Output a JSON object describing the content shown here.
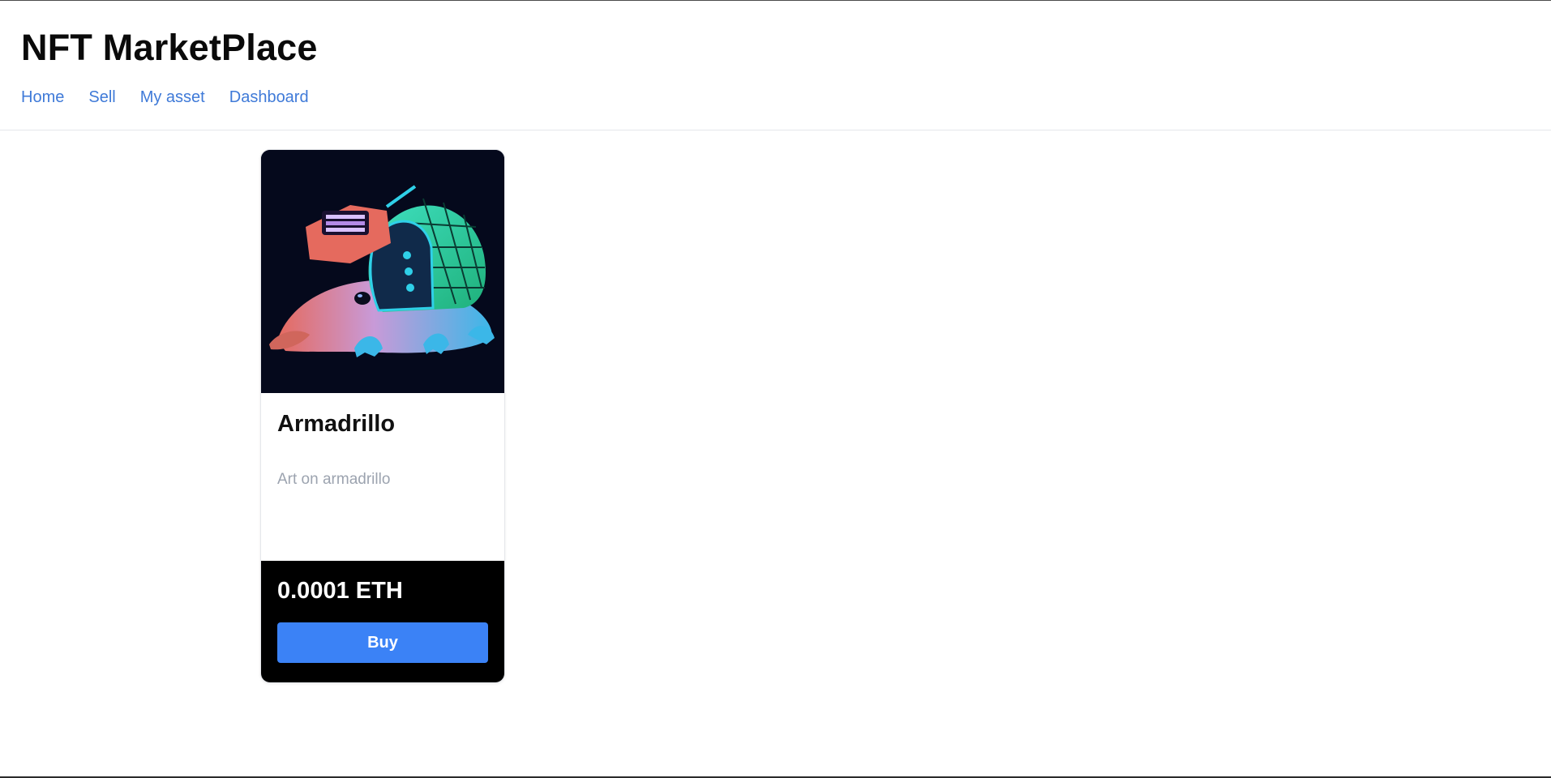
{
  "header": {
    "title": "NFT MarketPlace",
    "nav": [
      {
        "label": "Home"
      },
      {
        "label": "Sell"
      },
      {
        "label": "My asset"
      },
      {
        "label": "Dashboard"
      }
    ]
  },
  "nft_cards": [
    {
      "name": "Armadrillo",
      "description": "Art on armadrillo",
      "price": "0.0001 ETH",
      "buy_label": "Buy",
      "image": "armadillo-cyberpunk-art"
    }
  ],
  "colors": {
    "nav_link": "#3f7ad8",
    "buy_button": "#3b82f6",
    "card_footer_bg": "#000000",
    "image_bg": "#05091c"
  }
}
